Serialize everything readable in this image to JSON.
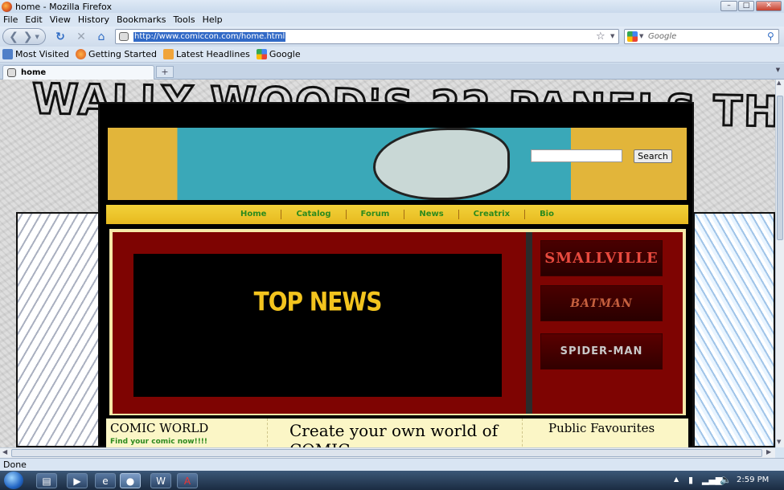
{
  "window": {
    "title": "home - Mozilla Firefox"
  },
  "menu": [
    "File",
    "Edit",
    "View",
    "History",
    "Bookmarks",
    "Tools",
    "Help"
  ],
  "nav": {
    "url": "http://www.comiccon.com/home.html",
    "search_placeholder": "Google"
  },
  "bookmarks": [
    "Most Visited",
    "Getting Started",
    "Latest Headlines",
    "Google"
  ],
  "tab": {
    "label": "home",
    "new_tab": "+"
  },
  "site": {
    "search_button": "Search",
    "nav_links": [
      "Home",
      "Catalog",
      "Forum",
      "News",
      "Creatrix",
      "Bio"
    ],
    "top_news": "TOP NEWS",
    "promos": [
      "SMALLVILLE",
      "BATMAN",
      "SPIDER-MAN"
    ],
    "comic_world_title": "COMIC WORLD",
    "comic_world_link": "Find your comic now!!!!",
    "create_heading": "Create your own world of COMIC",
    "public_favourites": "Public Favourites"
  },
  "status": {
    "text": "Done"
  },
  "taskbar": {
    "clock": "2:59 PM"
  },
  "colors": {
    "accent": "#3169c6",
    "nav_green": "#2c8a1d",
    "news_red": "#7e0402",
    "news_yellow": "#f3c41e"
  }
}
